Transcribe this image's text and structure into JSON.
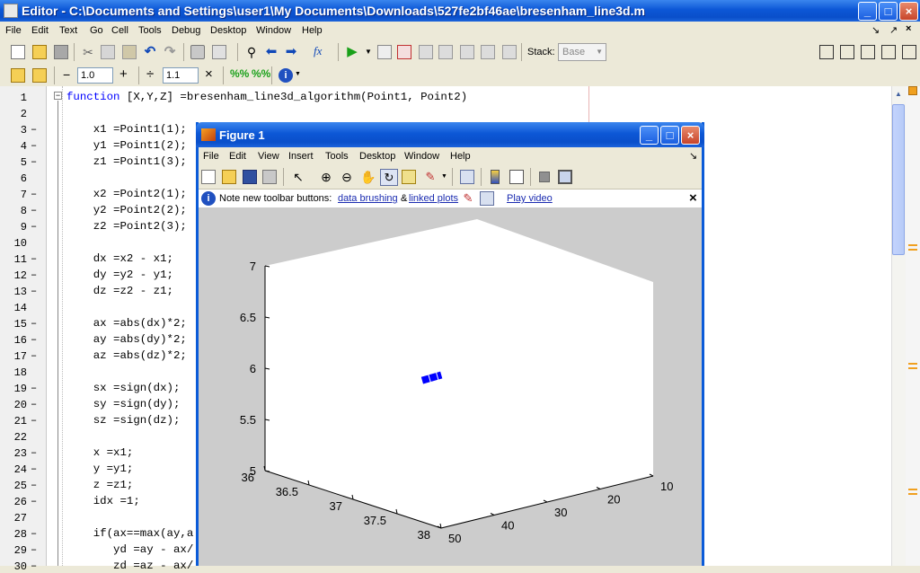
{
  "window": {
    "title": "Editor - C:\\Documents and Settings\\user1\\My Documents\\Downloads\\527fe2bf46ae\\bresenham_line3d.m"
  },
  "menu": [
    "File",
    "Edit",
    "Text",
    "Go",
    "Cell",
    "Tools",
    "Debug",
    "Desktop",
    "Window",
    "Help"
  ],
  "toolbar": {
    "stack_label": "Stack:",
    "stack_value": "Base"
  },
  "cell_toolbar": {
    "minus": "−",
    "value1": "1.0",
    "plus": "+",
    "divide": "÷",
    "value2": "1.1",
    "times": "×"
  },
  "code": {
    "lines": [
      {
        "n": "1",
        "dash": "",
        "text": "function [X,Y,Z] =bresenham_line3d_algorithm(Point1, Point2)"
      },
      {
        "n": "2",
        "dash": "",
        "text": ""
      },
      {
        "n": "3",
        "dash": "–",
        "text": "    x1 =Point1(1);"
      },
      {
        "n": "4",
        "dash": "–",
        "text": "    y1 =Point1(2);"
      },
      {
        "n": "5",
        "dash": "–",
        "text": "    z1 =Point1(3);"
      },
      {
        "n": "6",
        "dash": "",
        "text": ""
      },
      {
        "n": "7",
        "dash": "–",
        "text": "    x2 =Point2(1);"
      },
      {
        "n": "8",
        "dash": "–",
        "text": "    y2 =Point2(2);"
      },
      {
        "n": "9",
        "dash": "–",
        "text": "    z2 =Point2(3);"
      },
      {
        "n": "10",
        "dash": "",
        "text": ""
      },
      {
        "n": "11",
        "dash": "–",
        "text": "    dx =x2 - x1;"
      },
      {
        "n": "12",
        "dash": "–",
        "text": "    dy =y2 - y1;"
      },
      {
        "n": "13",
        "dash": "–",
        "text": "    dz =z2 - z1;"
      },
      {
        "n": "14",
        "dash": "",
        "text": ""
      },
      {
        "n": "15",
        "dash": "–",
        "text": "    ax =abs(dx)*2;"
      },
      {
        "n": "16",
        "dash": "–",
        "text": "    ay =abs(dy)*2;"
      },
      {
        "n": "17",
        "dash": "–",
        "text": "    az =abs(dz)*2;"
      },
      {
        "n": "18",
        "dash": "",
        "text": ""
      },
      {
        "n": "19",
        "dash": "–",
        "text": "    sx =sign(dx);"
      },
      {
        "n": "20",
        "dash": "–",
        "text": "    sy =sign(dy);"
      },
      {
        "n": "21",
        "dash": "–",
        "text": "    sz =sign(dz);"
      },
      {
        "n": "22",
        "dash": "",
        "text": ""
      },
      {
        "n": "23",
        "dash": "–",
        "text": "    x =x1;"
      },
      {
        "n": "24",
        "dash": "–",
        "text": "    y =y1;"
      },
      {
        "n": "25",
        "dash": "–",
        "text": "    z =z1;"
      },
      {
        "n": "26",
        "dash": "–",
        "text": "    idx =1;"
      },
      {
        "n": "27",
        "dash": "",
        "text": ""
      },
      {
        "n": "28",
        "dash": "–",
        "text": "    if(ax==max(ay,a"
      },
      {
        "n": "29",
        "dash": "–",
        "text": "       yd =ay - ax/"
      },
      {
        "n": "30",
        "dash": "–",
        "text": "       zd =az - ax/"
      }
    ]
  },
  "figure": {
    "title": "Figure 1",
    "menu": [
      "File",
      "Edit",
      "View",
      "Insert",
      "Tools",
      "Desktop",
      "Window",
      "Help"
    ],
    "info_text": "Note new toolbar buttons:",
    "link1": "data brushing",
    "amp": "&",
    "link2": "linked plots",
    "link3": "Play video",
    "close": "×"
  },
  "chart_data": {
    "type": "line",
    "title": "",
    "x_ticks": [
      "10",
      "20",
      "30",
      "40",
      "50"
    ],
    "y_ticks": [
      "36",
      "36.5",
      "37",
      "37.5",
      "38"
    ],
    "z_ticks": [
      "5",
      "5.5",
      "6",
      "6.5",
      "7"
    ],
    "xlim": [
      10,
      50
    ],
    "ylim": [
      36,
      38
    ],
    "zlim": [
      5,
      7
    ],
    "series": [
      {
        "color": "#0000ff",
        "x": [
          27,
          40
        ],
        "y": [
          36.4,
          37.4
        ],
        "z": [
          5.7,
          6.2
        ]
      }
    ]
  }
}
